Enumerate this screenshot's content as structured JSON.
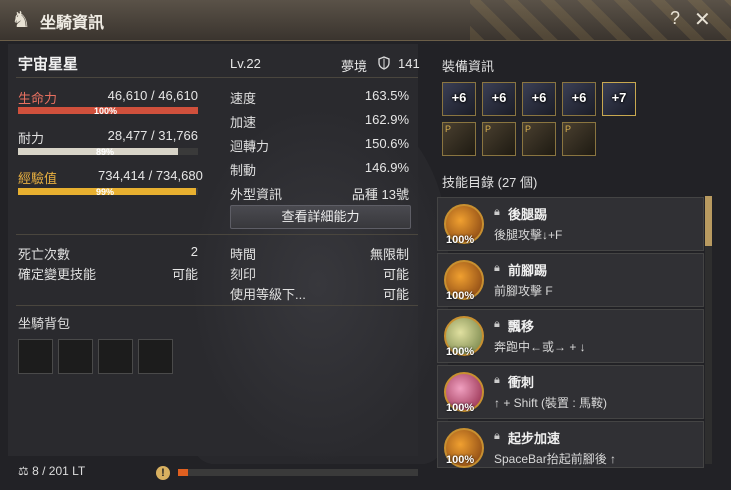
{
  "window": {
    "title": "坐騎資訊"
  },
  "mount": {
    "name": "宇宙星星",
    "level": "Lv.22",
    "type": "夢境",
    "defense": "141"
  },
  "stats": {
    "hp": {
      "label": "生命力",
      "value": "46,610 / 46,610",
      "pct": "100%",
      "fraction": 1.0
    },
    "stamina": {
      "label": "耐力",
      "value": "28,477 / 31,766",
      "pct": "89%",
      "fraction": 0.89
    },
    "exp": {
      "label": "經驗值",
      "value": "734,414 / 734,680",
      "pct": "99%",
      "fraction": 0.99
    }
  },
  "attrs": [
    {
      "label": "速度",
      "value": "163.5%"
    },
    {
      "label": "加速",
      "value": "162.9%"
    },
    {
      "label": "迴轉力",
      "value": "150.6%"
    },
    {
      "label": "制動",
      "value": "146.9%"
    },
    {
      "label": "外型資訊",
      "value": "品種 13號"
    }
  ],
  "detail_button": "查看詳細能力",
  "info": {
    "deaths_label": "死亡次數",
    "deaths_value": "2",
    "skill_change_label": "確定變更技能",
    "skill_change_value": "可能",
    "time_label": "時間",
    "time_value": "無限制",
    "imprint_label": "刻印",
    "imprint_value": "可能",
    "use_level_label": "使用等級下...",
    "use_level_value": "可能"
  },
  "bag": {
    "title": "坐騎背包",
    "weight": "8 / 201 LT",
    "weight_fraction": 0.04
  },
  "equipment": {
    "title": "裝備資訊",
    "upper": [
      "+6",
      "+6",
      "+6",
      "+6",
      "+7"
    ],
    "lower_marker": "P"
  },
  "skills": {
    "title": "技能目錄 (27 個)",
    "items": [
      {
        "name": "後腿踢",
        "desc": "後腿攻擊↓+F",
        "pct": "100%"
      },
      {
        "name": "前腳踢",
        "desc": "前腳攻擊 F",
        "pct": "100%"
      },
      {
        "name": "飄移",
        "desc": "奔跑中←或→ + ↓",
        "pct": "100%"
      },
      {
        "name": "衝刺",
        "desc": "↑ + Shift (裝置 : 馬鞍)",
        "pct": "100%"
      },
      {
        "name": "起步加速",
        "desc": "SpaceBar抬起前腳後 ↑",
        "pct": "100%"
      }
    ]
  },
  "colors": {
    "hp": "#d0503c",
    "stamina": "#d8d4c8",
    "exp": "#e8b030",
    "accent": "#b89a60"
  }
}
